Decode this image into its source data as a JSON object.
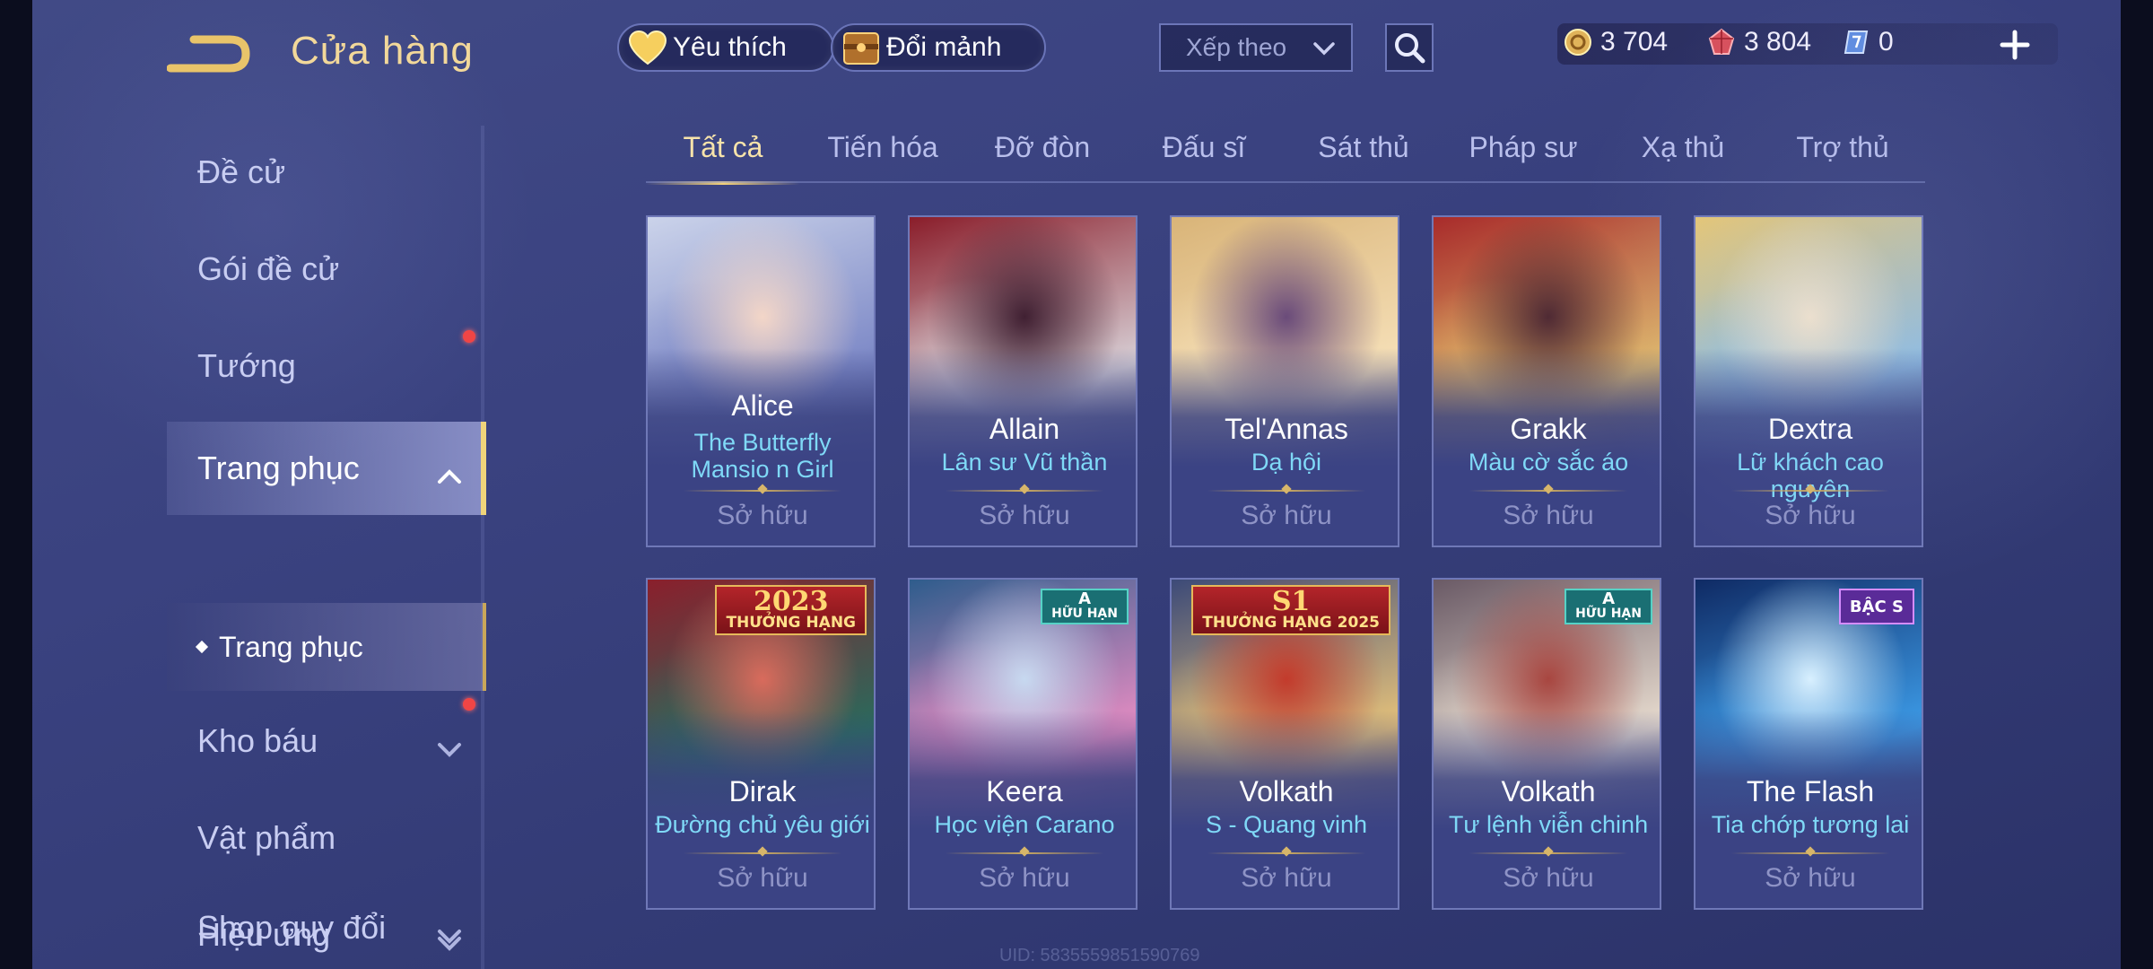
{
  "header": {
    "title": "Cửa hàng",
    "favorites_label": "Yêu thích",
    "shards_label": "Đổi mảnh",
    "sort_placeholder": "Xếp theo",
    "currencies": [
      {
        "icon": "gold-coin-icon",
        "value": "3 704"
      },
      {
        "icon": "ruby-icon",
        "value": "3 804"
      },
      {
        "icon": "voucher-icon",
        "value": "0"
      }
    ]
  },
  "sidebar": {
    "items": [
      {
        "label": "Đề cử"
      },
      {
        "label": "Gói đề cử",
        "notification": true
      },
      {
        "label": "Tướng"
      },
      {
        "label": "Trang phục",
        "expanded": true,
        "active": true
      },
      {
        "label": "Kho báu",
        "notification": true
      },
      {
        "label": "Vật phẩm"
      },
      {
        "label": "Hiệu ứng"
      },
      {
        "label": "Shop quy đổi"
      }
    ],
    "sub_item": "Trang phục"
  },
  "tabs": [
    "Tất cả",
    "Tiến hóa",
    "Đỡ đòn",
    "Đấu sĩ",
    "Sát thủ",
    "Pháp sư",
    "Xạ thủ",
    "Trợ thủ"
  ],
  "active_tab": "Tất cả",
  "cards": [
    {
      "hero": "Alice",
      "skin": "The Butterfly Mansio n Girl",
      "status": "Sở hữu",
      "badge": null
    },
    {
      "hero": "Allain",
      "skin": "Lân sư Vũ thần",
      "status": "Sở hữu",
      "badge": null
    },
    {
      "hero": "Tel'Annas",
      "skin": "Dạ hội",
      "status": "Sở hữu",
      "badge": null
    },
    {
      "hero": "Grakk",
      "skin": "Màu cờ sắc áo",
      "status": "Sở hữu",
      "badge": null
    },
    {
      "hero": "Dextra",
      "skin": "Lữ khách cao nguyên",
      "status": "Sở hữu",
      "badge": null
    },
    {
      "hero": "Dirak",
      "skin": "Đường chủ yêu giới",
      "status": "Sở hữu",
      "badge": {
        "type": "rank",
        "top": "2023",
        "bottom": "THƯỞNG HẠNG"
      }
    },
    {
      "hero": "Keera",
      "skin": "Học viện Carano",
      "status": "Sở hữu",
      "badge": {
        "type": "limited",
        "top": "A",
        "bottom": "HỮU HẠN"
      }
    },
    {
      "hero": "Volkath",
      "skin": "S - Quang vinh",
      "status": "Sở hữu",
      "badge": {
        "type": "rank",
        "top": "S1",
        "bottom": "THƯỞNG HẠNG 2025"
      }
    },
    {
      "hero": "Volkath",
      "skin": "Tư lệnh viễn chinh",
      "status": "Sở hữu",
      "badge": {
        "type": "limited",
        "top": "A",
        "bottom": "HỮU HẠN"
      }
    },
    {
      "hero": "The Flash",
      "skin": "Tia chớp tương lai",
      "status": "Sở hữu",
      "badge": {
        "type": "tier",
        "top": "BẬC S"
      }
    }
  ],
  "footer": {
    "uid": "UID: 5835559851590769"
  },
  "colors": {
    "accent_gold": "#f2d89a",
    "skin_name": "#7fd9f7",
    "notification": "#f04545"
  }
}
